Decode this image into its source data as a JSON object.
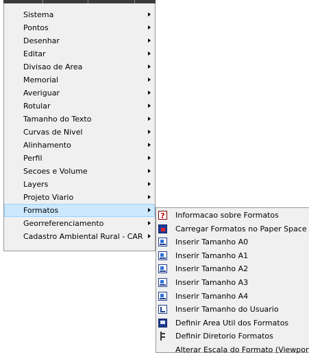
{
  "main_menu": {
    "items": [
      {
        "label": "Sistema",
        "has_submenu": true
      },
      {
        "label": "Pontos",
        "has_submenu": true
      },
      {
        "label": "Desenhar",
        "has_submenu": true
      },
      {
        "label": "Editar",
        "has_submenu": true
      },
      {
        "label": "Divisao de Area",
        "has_submenu": true
      },
      {
        "label": "Memorial",
        "has_submenu": true
      },
      {
        "label": "Averiguar",
        "has_submenu": true
      },
      {
        "label": "Rotular",
        "has_submenu": true
      },
      {
        "label": "Tamanho do Texto",
        "has_submenu": true
      },
      {
        "label": "Curvas de Nivel",
        "has_submenu": true
      },
      {
        "label": "Alinhamento",
        "has_submenu": true
      },
      {
        "label": "Perfil",
        "has_submenu": true
      },
      {
        "label": "Secoes e Volume",
        "has_submenu": true
      },
      {
        "label": "Layers",
        "has_submenu": true
      },
      {
        "label": "Projeto Viario",
        "has_submenu": true
      },
      {
        "label": "Formatos",
        "has_submenu": true,
        "highlighted": true
      },
      {
        "label": "Georreferenciamento",
        "has_submenu": true
      },
      {
        "label": "Cadastro Ambiental Rural - CAR",
        "has_submenu": true
      }
    ]
  },
  "sub_menu": {
    "items": [
      {
        "label": "Informacao sobre Formatos",
        "icon": "info-icon"
      },
      {
        "label": "Carregar Formatos no Paper Space",
        "icon": "paper-space-icon"
      },
      {
        "label": "Inserir Tamanho A0",
        "icon": "sheet-a0-icon"
      },
      {
        "label": "Inserir Tamanho A1",
        "icon": "sheet-a1-icon"
      },
      {
        "label": "Inserir Tamanho A2",
        "icon": "sheet-a2-icon"
      },
      {
        "label": "Inserir Tamanho A3",
        "icon": "sheet-a3-icon"
      },
      {
        "label": "Inserir Tamanho A4",
        "icon": "sheet-a4-icon"
      },
      {
        "label": "Inserir Tamanho do Usuario",
        "icon": "user-size-icon"
      },
      {
        "label": "Definir Area Util dos Formatos",
        "icon": "usable-area-icon"
      },
      {
        "label": "Definir Diretorio Formatos",
        "icon": "directory-icon"
      },
      {
        "label": "Alterar Escala do Formato (Viewport)",
        "icon": ""
      }
    ]
  },
  "colors": {
    "menu_background": "#f0f0f0",
    "menu_border": "#979797",
    "highlight_background": "#cce8ff",
    "highlight_border": "#99d1ff",
    "menubar": "#3b3b3b"
  }
}
